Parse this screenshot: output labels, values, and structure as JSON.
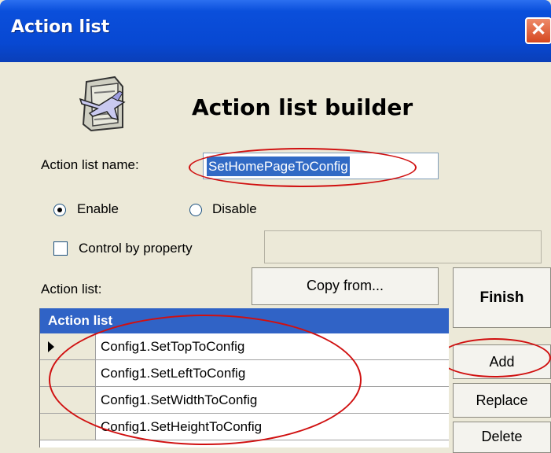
{
  "window": {
    "title": "Action list",
    "close_glyph": "✕"
  },
  "header": {
    "heading": "Action list builder",
    "icon": "airplane-document-icon"
  },
  "form": {
    "name_label": "Action list name:",
    "name_value": "SetHomePageToConfig",
    "enable_label": "Enable",
    "disable_label": "Disable",
    "enable_selected": true,
    "control_by_property_label": "Control by property",
    "control_by_property_checked": false,
    "property_value": ""
  },
  "list_section": {
    "label": "Action list:",
    "copy_from_label": "Copy from...",
    "column_header": "Action list",
    "rows": [
      {
        "value": "Config1.SetTopToConfig",
        "current": true
      },
      {
        "value": "Config1.SetLeftToConfig",
        "current": false
      },
      {
        "value": "Config1.SetWidthToConfig",
        "current": false
      },
      {
        "value": "Config1.SetHeightToConfig",
        "current": false
      }
    ]
  },
  "buttons": {
    "finish": "Finish",
    "add": "Add",
    "replace": "Replace",
    "delete": "Delete"
  },
  "colors": {
    "titlebar": "#0848d2",
    "selection": "#316ac5",
    "annotation": "#d01010",
    "face": "#ece9d8"
  }
}
